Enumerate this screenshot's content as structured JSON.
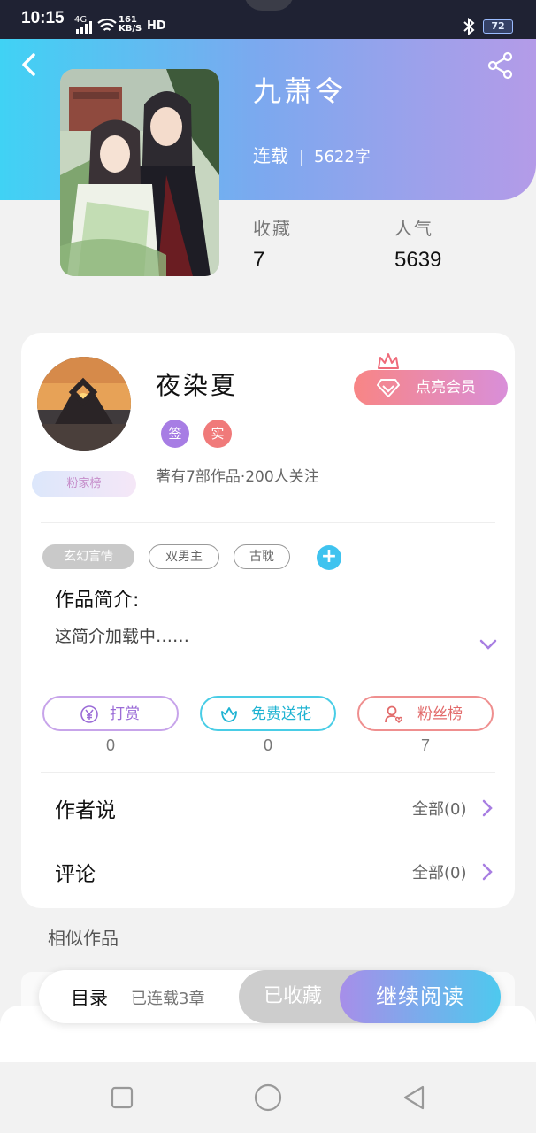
{
  "status_bar": {
    "time": "10:15",
    "network": "4G",
    "speed_value": "161",
    "speed_unit": "KB/S",
    "hd": "HD",
    "battery": "72"
  },
  "book": {
    "title": "九萧令",
    "status": "连载",
    "word_count": "5622字",
    "collect_label": "收藏",
    "collect_value": "7",
    "popularity_label": "人气",
    "popularity_value": "5639"
  },
  "author": {
    "name": "夜染夏",
    "badge_sign": "签",
    "badge_real": "实",
    "meta": "著有7部作品·200人关注",
    "fan_tag": "粉家榜",
    "vip_button": "点亮会员"
  },
  "tags": [
    "玄幻言情",
    "双男主",
    "古耽"
  ],
  "intro": {
    "title": "作品简介:",
    "text": "这简介加载中……"
  },
  "actions": [
    {
      "label": "打赏",
      "count": "0"
    },
    {
      "label": "免费送花",
      "count": "0"
    },
    {
      "label": "粉丝榜",
      "count": "7"
    }
  ],
  "rows": [
    {
      "title": "作者说",
      "right": "全部(0)"
    },
    {
      "title": "评论",
      "right": "全部(0)"
    }
  ],
  "similar_title": "相似作品",
  "bottom_bar": {
    "toc": "目录",
    "chapters": "已连载3章",
    "collected": "已收藏",
    "read": "继续阅读"
  },
  "colors": {
    "header_start": "#40d2f4",
    "header_end": "#b49be8",
    "accent_purple": "#a77de4",
    "accent_red": "#f07a7a",
    "accent_cyan": "#49cde6"
  },
  "icons": [
    "back-icon",
    "share-icon",
    "crown-icon",
    "diamond-icon",
    "plus-icon",
    "chevron-down-icon",
    "yen-icon",
    "flower-icon",
    "user-heart-icon",
    "chevron-right-icon",
    "square-nav-icon",
    "circle-nav-icon",
    "triangle-back-nav-icon"
  ]
}
